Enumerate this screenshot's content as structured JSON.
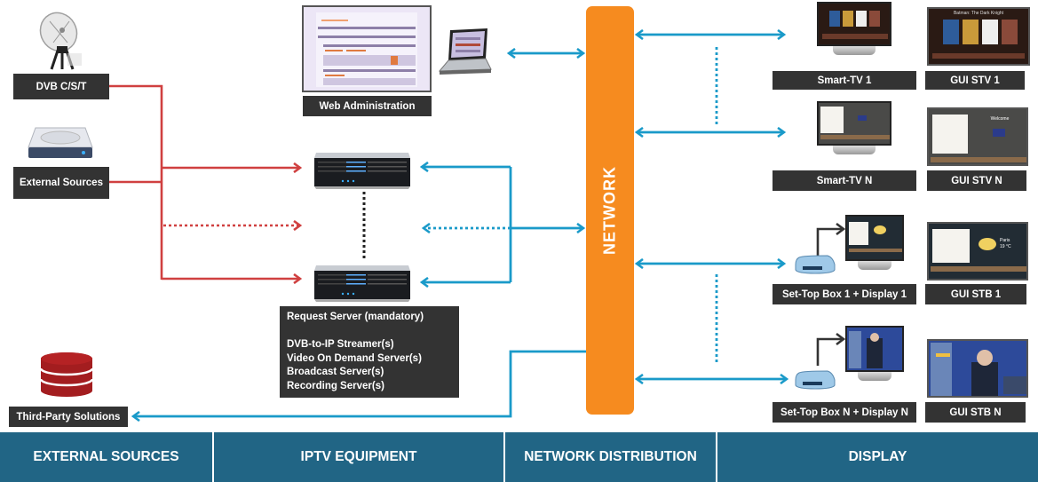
{
  "colors": {
    "network": "#f68b1f",
    "source_line": "#d04040",
    "distribution_line": "#1a9ac9",
    "label_bg": "#333333",
    "footer_bg": "#216585"
  },
  "external_sources": {
    "dvb": {
      "label": "DVB C/S/T",
      "icon": "satellite-dish-icon"
    },
    "external": {
      "label": "External Sources",
      "icon": "hard-drive-icon"
    },
    "third_party": {
      "label": "Third-Party Solutions",
      "icon": "database-icon"
    }
  },
  "iptv_equipment": {
    "web_admin": {
      "label": "Web Administration",
      "icons": [
        "admin-screenshot",
        "laptop-icon"
      ]
    },
    "servers_info": [
      "Request Server (mandatory)",
      "",
      "DVB-to-IP Streamer(s)",
      "Video On Demand Server(s)",
      "Broadcast  Server(s)",
      "Recording Server(s)"
    ]
  },
  "network": {
    "label": "NETWORK"
  },
  "display": {
    "devices": [
      {
        "label": "Smart-TV 1",
        "gui_label": "GUI STV 1"
      },
      {
        "label": "Smart-TV N",
        "gui_label": "GUI STV N"
      },
      {
        "label": "Set-Top Box  1 + Display 1",
        "gui_label": "GUI STB 1"
      },
      {
        "label": "Set-Top Box N + Display N",
        "gui_label": "GUI STB N"
      }
    ],
    "screen_texts": {
      "movie_title": "Batman: The Dark Knight",
      "welcome": "Welcome",
      "weather_city": "Paris",
      "weather_temp": "19 °C"
    }
  },
  "footer": {
    "sections": [
      "EXTERNAL SOURCES",
      "IPTV EQUIPMENT",
      "NETWORK DISTRIBUTION",
      "DISPLAY"
    ]
  }
}
